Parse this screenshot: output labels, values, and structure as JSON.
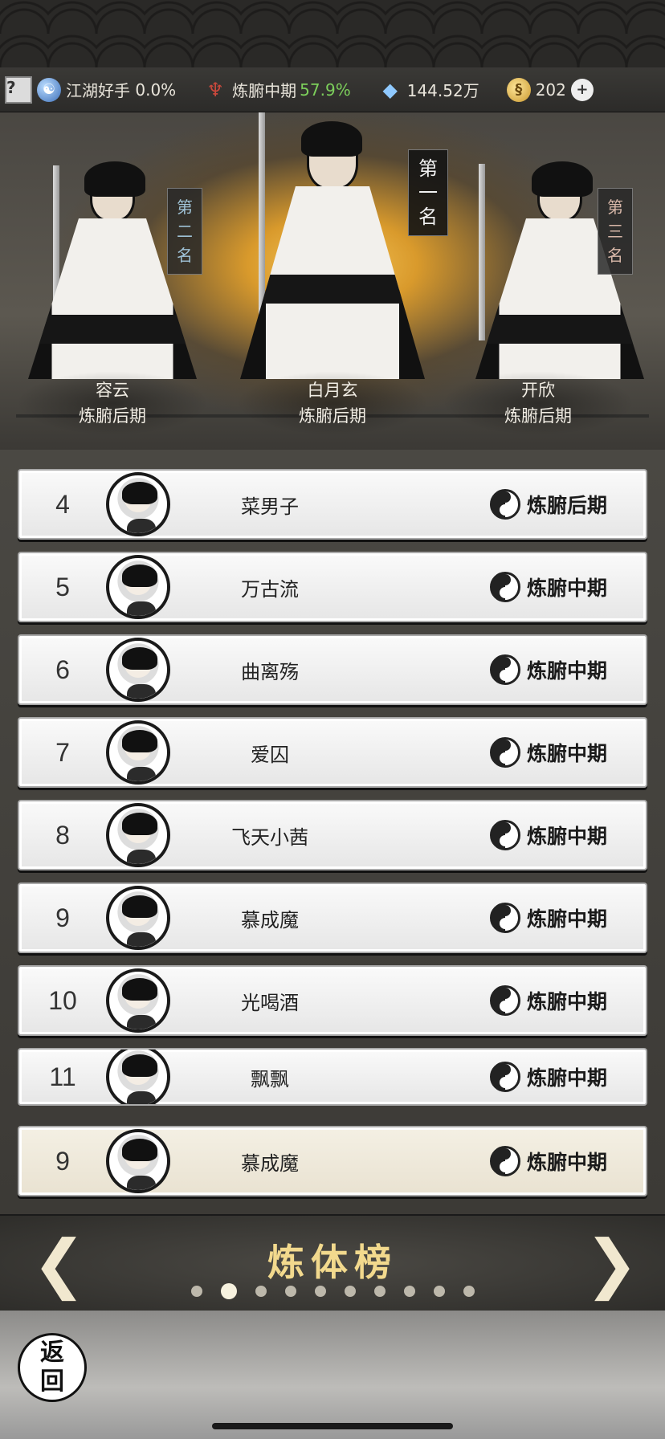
{
  "resources": {
    "item1_label": "江湖好手",
    "item1_value": "0.0%",
    "item2_label": "炼腑中期",
    "item2_value": "57.9%",
    "item3_value": "144.52万",
    "item4_value": "202"
  },
  "podium": {
    "first": {
      "rank_chars": [
        "第",
        "一",
        "名"
      ],
      "name": "白月玄",
      "realm": "炼腑后期"
    },
    "second": {
      "rank_chars": [
        "第",
        "二",
        "名"
      ],
      "name": "容云",
      "realm": "炼腑后期"
    },
    "third": {
      "rank_chars": [
        "第",
        "三",
        "名"
      ],
      "name": "开欣",
      "realm": "炼腑后期"
    }
  },
  "rows": [
    {
      "rank": "4",
      "name": "菜男子",
      "realm": "炼腑后期"
    },
    {
      "rank": "5",
      "name": "万古流",
      "realm": "炼腑中期"
    },
    {
      "rank": "6",
      "name": "曲离殇",
      "realm": "炼腑中期"
    },
    {
      "rank": "7",
      "name": "爱囚",
      "realm": "炼腑中期"
    },
    {
      "rank": "8",
      "name": "飞天小茜",
      "realm": "炼腑中期"
    },
    {
      "rank": "9",
      "name": "慕成魔",
      "realm": "炼腑中期"
    },
    {
      "rank": "10",
      "name": "光喝酒",
      "realm": "炼腑中期"
    },
    {
      "rank": "11",
      "name": "飘飘",
      "realm": "炼腑中期"
    }
  ],
  "self_row": {
    "rank": "9",
    "name": "慕成魔",
    "realm": "炼腑中期"
  },
  "tab": {
    "title": "炼体榜",
    "left_arrow": "❮",
    "right_arrow": "❯"
  },
  "back": {
    "char1": "返",
    "char2": "回"
  },
  "icons": {
    "help": "?",
    "taiji": "☯",
    "trident": "♆",
    "crystal": "◆",
    "coin": "§",
    "plus": "+"
  }
}
